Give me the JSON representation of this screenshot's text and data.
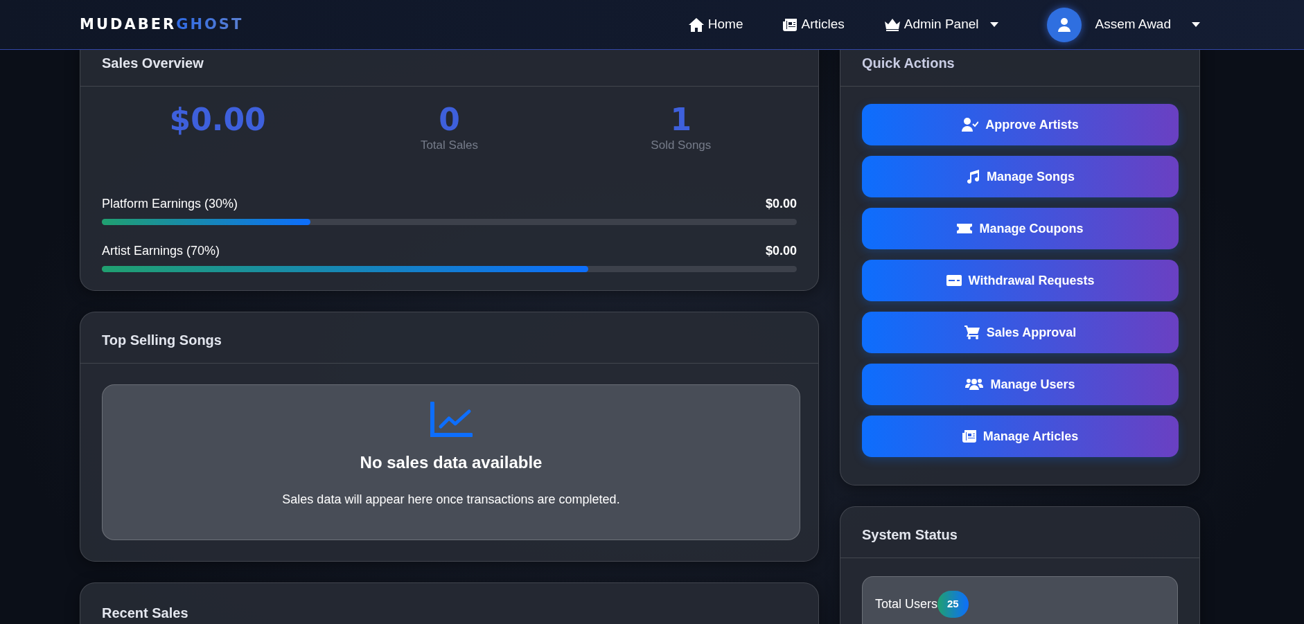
{
  "navbar": {
    "brand": {
      "main": "MUDABER",
      "accent": "GHOST"
    },
    "links": [
      {
        "label": "Home",
        "dropdown": false
      },
      {
        "label": "Articles",
        "dropdown": false
      },
      {
        "label": "Admin Panel",
        "dropdown": true
      }
    ],
    "user": {
      "name": "Assem Awad",
      "dropdown": true
    }
  },
  "sales_overview": {
    "title": "Sales Overview",
    "stats": [
      {
        "value": "$0.00"
      },
      {
        "value": "0",
        "label": "Total Sales"
      },
      {
        "value": "1",
        "label": "Sold Songs"
      }
    ],
    "earnings": [
      {
        "label": "Platform Earnings (30%)",
        "amount": "$0.00",
        "level": 0.3
      },
      {
        "label": "Artist Earnings (70%)",
        "amount": "$0.00",
        "level": 0.7
      }
    ]
  },
  "top_selling_songs": {
    "title": "Top Selling Songs",
    "empty_title": "No sales data available",
    "empty_text": "Sales data will appear here once transactions are completed."
  },
  "recent_sales": {
    "title": "Recent Sales"
  },
  "quick_actions": {
    "title": "Quick Actions",
    "buttons": [
      "Approve Artists",
      "Manage Songs",
      "Manage Coupons",
      "Withdrawal Requests",
      "Sales Approval",
      "Manage Users",
      "Manage Articles"
    ]
  },
  "system_status": {
    "title": "System Status",
    "items": [
      {
        "label": "Total Users",
        "count": "25"
      }
    ]
  }
}
